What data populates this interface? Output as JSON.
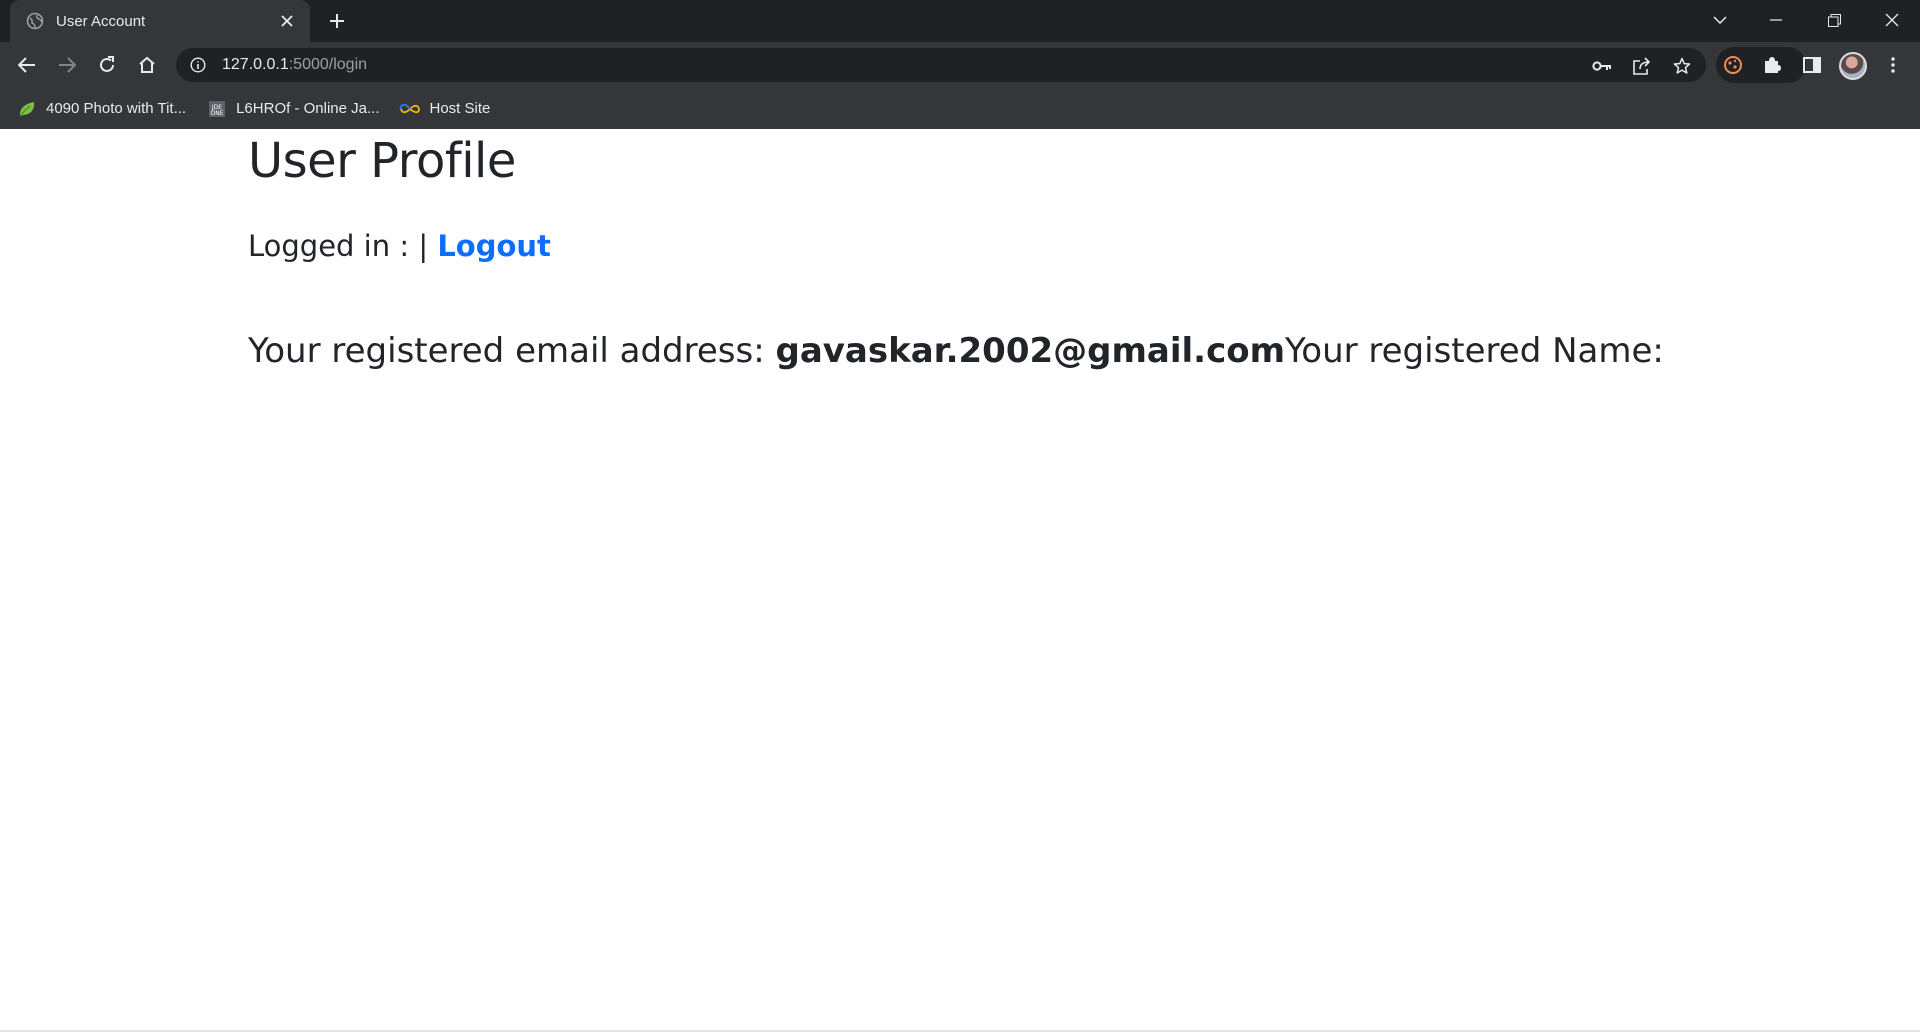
{
  "browser": {
    "tab_title": "User Account",
    "url_host": "127.0.0.1",
    "url_path": ":5000/login",
    "bookmarks": [
      {
        "label": "4090 Photo with Tit...",
        "icon": "leaf-icon"
      },
      {
        "label": "L6HROf - Online Ja...",
        "icon": "jdoodle-icon"
      },
      {
        "label": "Host Site",
        "icon": "infinity-icon"
      }
    ]
  },
  "page": {
    "title": "User Profile",
    "logged_in_label": "Logged in :",
    "separator": "|",
    "logout_label": "Logout",
    "email_label": "Your registered email address: ",
    "email_value": "gavaskar.2002@gmail.com",
    "name_label": "Your registered Name:",
    "logout_color": "#0d6efd",
    "text_color": "#212529"
  }
}
